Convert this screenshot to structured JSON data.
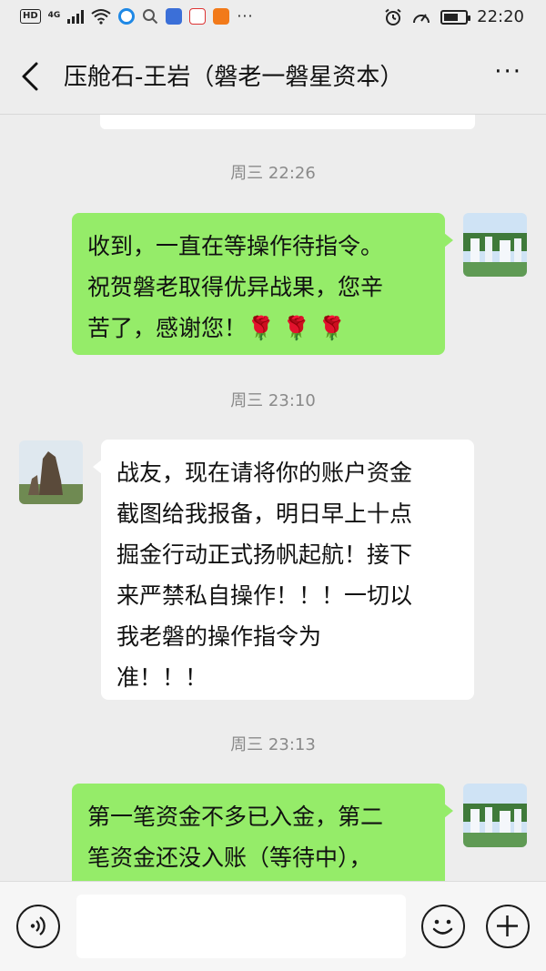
{
  "status": {
    "hd_label": "HD",
    "net_label": "4G",
    "time": "22:20",
    "left_icons": [
      "signal-bars-icon",
      "wifi-icon",
      "browser-app-icon",
      "search-icon",
      "tieba-app-icon",
      "sina-app-icon",
      "video-app-icon",
      "more-dots-icon"
    ],
    "right_icons": [
      "alarm-icon",
      "speedometer-icon",
      "battery-icon"
    ]
  },
  "header": {
    "title": "压舱石-王岩（磐老一磐星资本）",
    "more_label": "···"
  },
  "messages": [
    {
      "type": "time",
      "text": "周三 22:26"
    },
    {
      "type": "me",
      "lines": [
        "收到，一直在等操作待指令。",
        "祝贺磐老取得优异战果，您辛",
        "苦了，感谢您！"
      ],
      "emoji": "🌹 🌹 🌹"
    },
    {
      "type": "time",
      "text": "周三 23:10"
    },
    {
      "type": "them",
      "lines": [
        "战友，现在请将你的账户资金",
        "截图给我报备，明日早上十点",
        "掘金行动正式扬帆起航！接下",
        "来严禁私自操作！！！一切以",
        "我老磐的操作指令为",
        "准！！！"
      ]
    },
    {
      "type": "time",
      "text": "周三 23:13"
    },
    {
      "type": "me",
      "lines": [
        "第一笔资金不多已入金，第二",
        "笔资金还没入账（等待中），"
      ]
    }
  ],
  "input": {
    "placeholder": ""
  },
  "colors": {
    "background": "#ededed",
    "my_bubble": "#95ec69",
    "their_bubble": "#ffffff",
    "timestamp_text": "#8a8a8a"
  }
}
